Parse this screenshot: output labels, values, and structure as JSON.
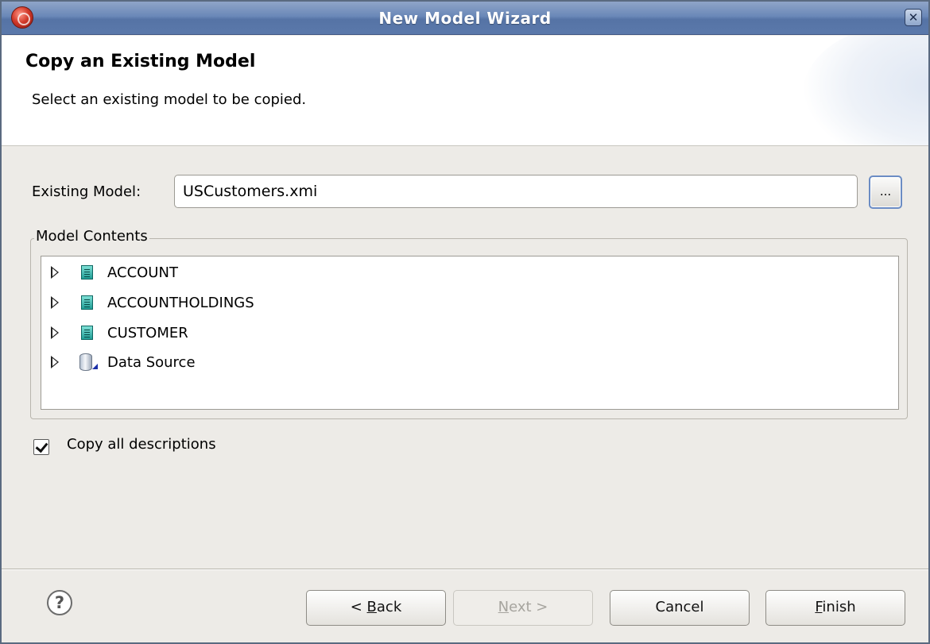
{
  "window": {
    "title": "New Model Wizard",
    "close_glyph": "✕"
  },
  "header": {
    "title": "Copy an Existing Model",
    "description": "Select an existing model to be copied."
  },
  "existing_model": {
    "label": "Existing Model:",
    "value": "USCustomers.xmi",
    "browse_label": "..."
  },
  "model_contents": {
    "legend": "Model Contents",
    "items": [
      {
        "label": "ACCOUNT",
        "icon": "table-icon"
      },
      {
        "label": "ACCOUNTHOLDINGS",
        "icon": "table-icon"
      },
      {
        "label": "CUSTOMER",
        "icon": "table-icon"
      },
      {
        "label": "Data Source",
        "icon": "data-source-icon"
      }
    ]
  },
  "options": {
    "copy_descriptions_label": "Copy all descriptions",
    "copy_descriptions_checked": true
  },
  "footer": {
    "help_glyph": "?",
    "back_prefix": "< ",
    "back_mnemonic": "B",
    "back_rest": "ack",
    "next_mnemonic": "N",
    "next_rest": "ext >",
    "cancel_label": "Cancel",
    "finish_mnemonic": "F",
    "finish_rest": "inish"
  },
  "colors": {
    "titlebar": "#6a88b8",
    "dialog_bg": "#edebe7",
    "table_icon": "#1f9d95"
  }
}
